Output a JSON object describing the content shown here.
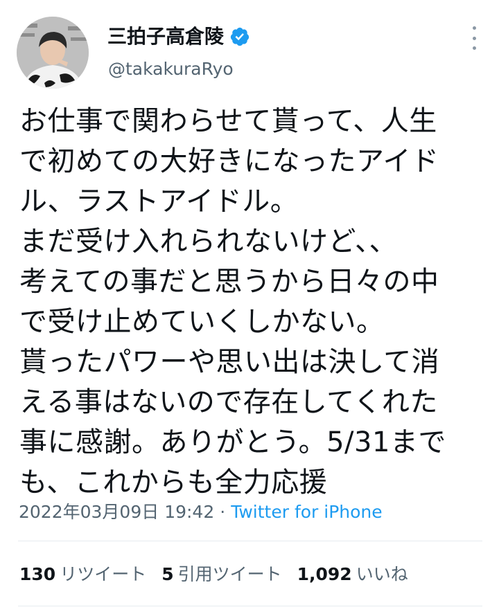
{
  "author": {
    "display_name": "三拍子高倉陵",
    "handle": "@takakuraRyo",
    "verified_icon": "verified-badge-icon",
    "avatar_icon": "avatar"
  },
  "tweet": {
    "lines": [
      "お仕事で関わらせて貰って、人生",
      "で初めての大好きになったアイド",
      "ル、ラストアイドル。",
      "まだ受け入れられないけど、、",
      "考えての事だと思うから日々の中",
      "で受け止めていくしかない。",
      "貰ったパワーや思い出は決して消",
      "える事はないので存在してくれた",
      "事に感謝。ありがとう。5/31まで",
      "も、これからも全力応援"
    ]
  },
  "meta": {
    "timestamp": "2022年03月09日 19:42",
    "separator": "·",
    "source": "Twitter for iPhone"
  },
  "stats": {
    "retweets_count": "130",
    "retweets_label": "リツイート",
    "quotes_count": "5",
    "quotes_label": "引用ツイート",
    "likes_count": "1,092",
    "likes_label": "いいね"
  },
  "colors": {
    "text": "#0f1419",
    "secondary": "#536471",
    "link": "#1d9bf0",
    "verified": "#1d9bf0",
    "divider": "#e6ecf0"
  }
}
